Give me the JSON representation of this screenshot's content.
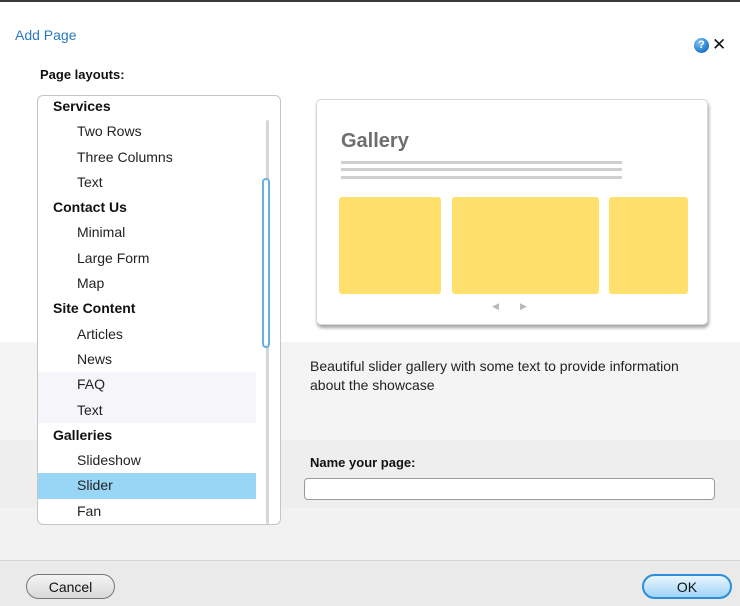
{
  "dialog": {
    "title": "Add Page",
    "help_symbol": "?",
    "close_symbol": "✕"
  },
  "layouts": {
    "label": "Page layouts:",
    "rows": [
      {
        "type": "group",
        "label": "Services"
      },
      {
        "type": "item",
        "label": "Two Rows"
      },
      {
        "type": "item",
        "label": "Three Columns"
      },
      {
        "type": "item",
        "label": "Text"
      },
      {
        "type": "group",
        "label": "Contact Us"
      },
      {
        "type": "item",
        "label": "Minimal"
      },
      {
        "type": "item",
        "label": "Large Form"
      },
      {
        "type": "item",
        "label": "Map"
      },
      {
        "type": "group",
        "label": "Site Content"
      },
      {
        "type": "item",
        "label": "Articles"
      },
      {
        "type": "item",
        "label": "News"
      },
      {
        "type": "item",
        "label": "FAQ"
      },
      {
        "type": "item",
        "label": "Text"
      },
      {
        "type": "group",
        "label": "Galleries"
      },
      {
        "type": "item",
        "label": "Slideshow"
      },
      {
        "type": "item",
        "label": "Slider",
        "selected": true
      },
      {
        "type": "item",
        "label": "Fan"
      }
    ]
  },
  "preview": {
    "title": "Gallery",
    "arrow_left": "◀",
    "arrow_right": "▶",
    "description": "Beautiful slider gallery with some text to provide information about the showcase"
  },
  "name_field": {
    "label": "Name your page:",
    "value": "",
    "placeholder": ""
  },
  "buttons": {
    "cancel": "Cancel",
    "ok": "OK"
  },
  "colors": {
    "accent": "#2a78bf",
    "selection": "#99d6f5",
    "tile": "#ffe06c"
  }
}
